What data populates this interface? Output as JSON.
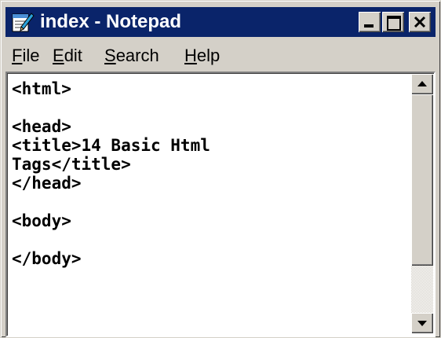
{
  "window": {
    "title": "index - Notepad",
    "icon": "notepad-icon"
  },
  "title_buttons": {
    "minimize_icon": "minimize-icon",
    "maximize_icon": "maximize-icon",
    "close_icon": "close-icon"
  },
  "menu": {
    "items": [
      {
        "label": "File"
      },
      {
        "label": "Edit"
      },
      {
        "label": "Search"
      },
      {
        "label": "Help"
      }
    ]
  },
  "editor": {
    "lines": [
      "<html>",
      "",
      "<head>",
      "<title>14 Basic Html",
      "Tags</title>",
      "</head>",
      "",
      "<body>",
      "",
      "</body>"
    ]
  },
  "colors": {
    "titlebar": "#0a246a",
    "chrome": "#d4d0c8",
    "editor_bg": "#ffffff"
  }
}
